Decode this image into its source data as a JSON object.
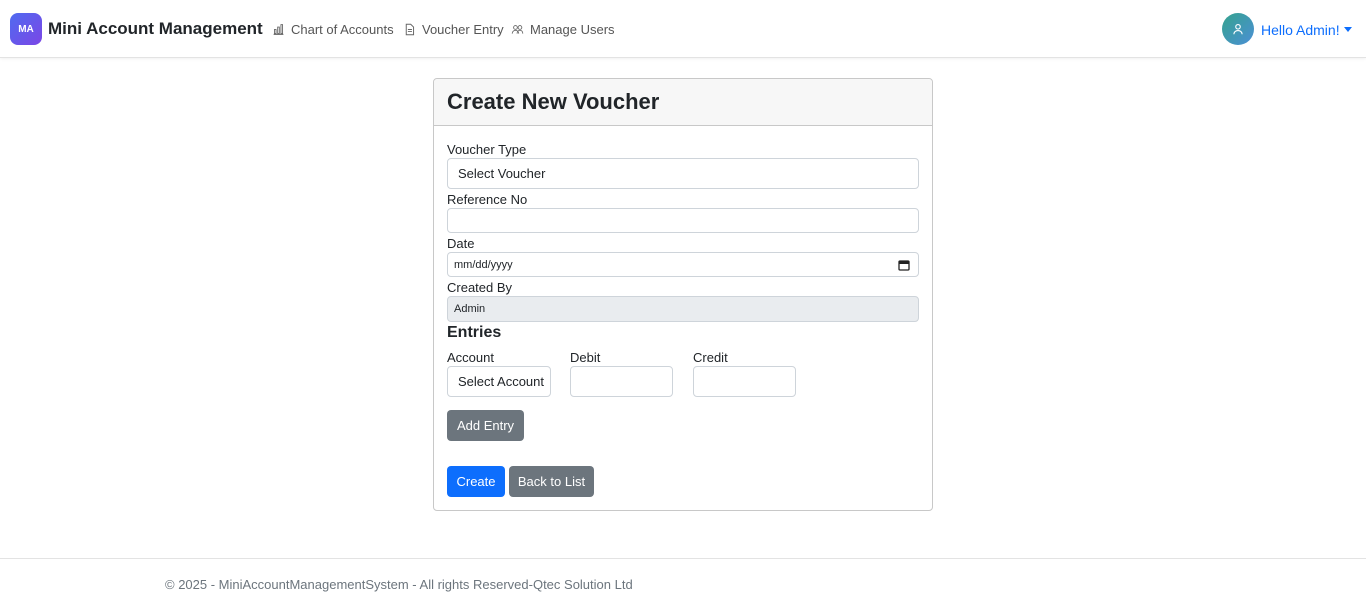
{
  "navbar": {
    "logo_initials": "MA",
    "brand": "Mini Account Management",
    "links": [
      {
        "label": "Chart of Accounts",
        "icon": "bar-chart-icon"
      },
      {
        "label": "Voucher Entry",
        "icon": "document-icon"
      },
      {
        "label": "Manage Users",
        "icon": "users-icon"
      }
    ],
    "user_greeting": "Hello Admin!",
    "user_icon": "user-icon"
  },
  "form": {
    "title": "Create New Voucher",
    "voucher_type_label": "Voucher Type",
    "voucher_type_value": "Select Voucher",
    "reference_label": "Reference No",
    "reference_value": "",
    "date_label": "Date",
    "date_placeholder": "mm/dd/yyyy",
    "created_by_label": "Created By",
    "created_by_value": "Admin",
    "entries_title": "Entries",
    "columns": {
      "account": "Account",
      "debit": "Debit",
      "credit": "Credit"
    },
    "account_value": "Select Account",
    "add_entry_label": "Add Entry",
    "create_label": "Create",
    "back_label": "Back to List"
  },
  "footer": {
    "text": "© 2025 - MiniAccountManagementSystem - All rights Reserved-Qtec Solution Ltd"
  },
  "colors": {
    "primary": "#0d6efd",
    "secondary": "#6c757d",
    "brand_gradient_start": "#4f6bf0",
    "brand_gradient_end": "#7b46e6"
  }
}
